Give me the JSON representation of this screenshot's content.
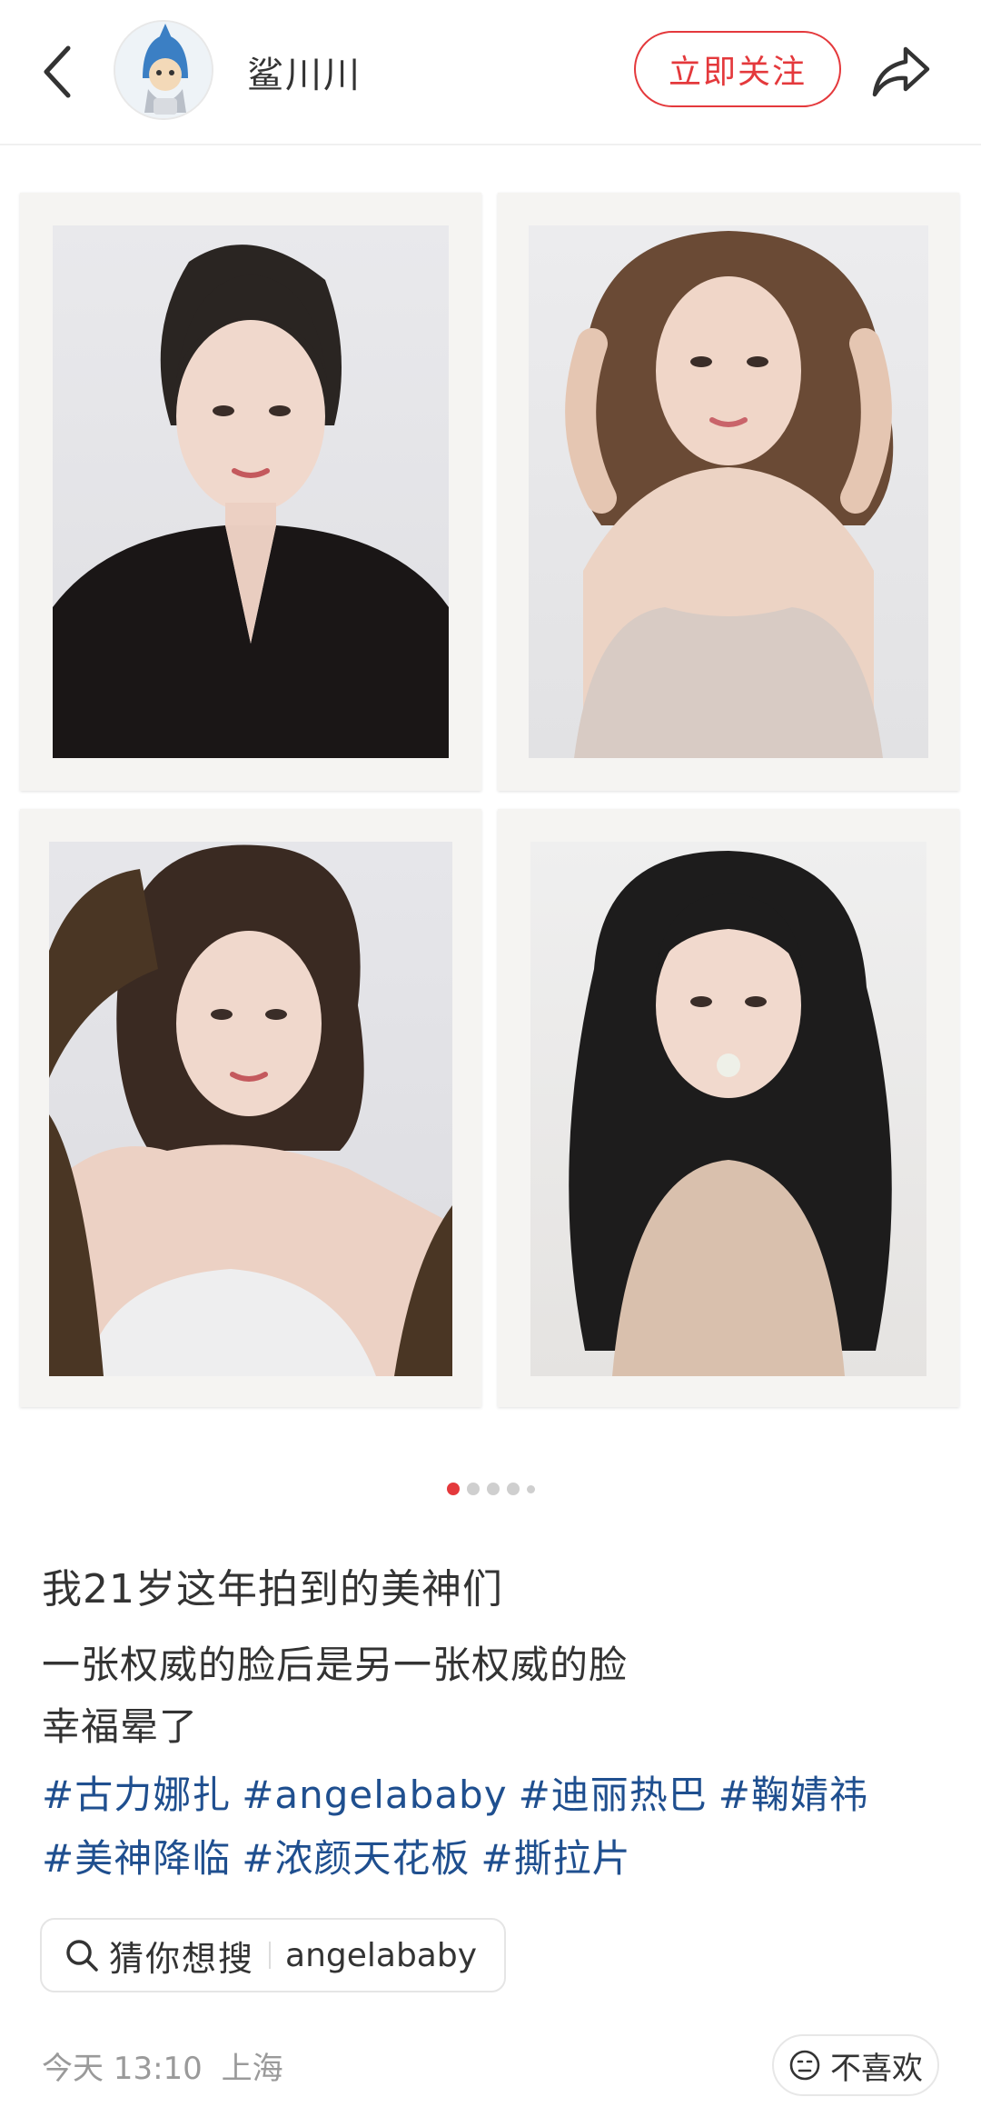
{
  "header": {
    "author_name": "鲨川川",
    "follow_label": "立即关注"
  },
  "gallery": {
    "image_count": 5,
    "current_index": 1
  },
  "post": {
    "title": "我21岁这年拍到的美神们",
    "lines": [
      "一张权威的脸后是另一张权威的脸",
      "幸福晕了"
    ],
    "tags": [
      "#古力娜扎",
      "#angelababy",
      "#迪丽热巴",
      "#鞠婧祎",
      "#美神降临",
      "#浓颜天花板",
      "#撕拉片"
    ]
  },
  "search": {
    "label": "猜你想搜",
    "term": "angelababy"
  },
  "footer": {
    "date": "今天 13:10",
    "location": "上海",
    "dislike_label": "不喜欢"
  },
  "colors": {
    "accent": "#e4393c",
    "tag": "#1f4f8f"
  }
}
